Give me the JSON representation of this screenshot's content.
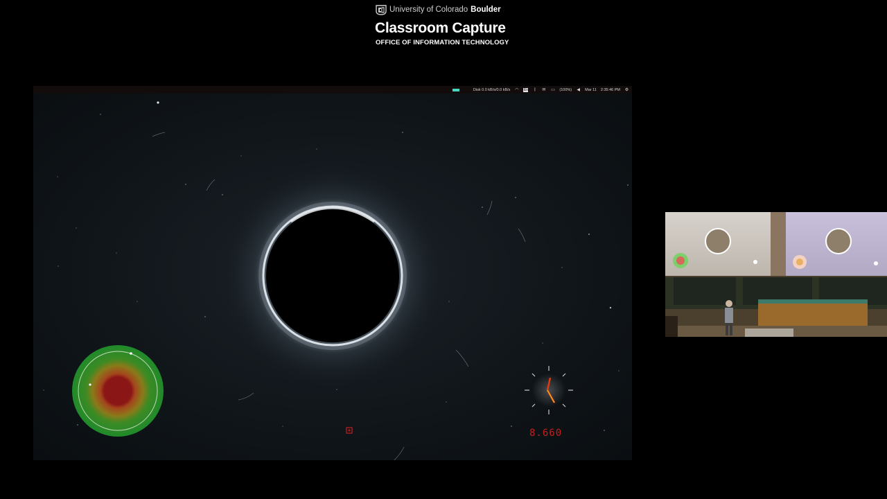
{
  "header": {
    "university_prefix": "University of Colorado",
    "university_campus": "Boulder",
    "title": "Classroom Capture",
    "subtitle": "OFFICE OF INFORMATION TECHNOLOGY"
  },
  "system_bar": {
    "disk": "Disk 0.0 kB/s/0.0 kB/s",
    "battery": "(100%)",
    "date": "Mar 11",
    "time": "2:35:46 PM",
    "icons": [
      "wifi-icon",
      "keyboard-icon",
      "bluetooth-icon",
      "mail-icon",
      "battery-icon",
      "volume-icon",
      "settings-gear-icon"
    ]
  },
  "simulation": {
    "readout": "8.660",
    "colors": {
      "ring": "#e8eef4",
      "radar_outer": "#1f8a2a",
      "radar_middle": "#8a7a1a",
      "radar_inner": "#8b1616",
      "readout": "#c81e1e",
      "gauge_needle": "#e03a12"
    }
  },
  "camera": {
    "left_projection": "black-hole-slide",
    "right_projection": "black-hole-slide"
  }
}
